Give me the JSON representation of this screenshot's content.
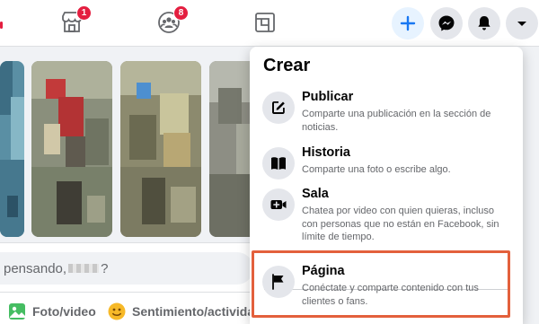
{
  "topbar": {
    "nav": [
      {
        "name": "marketplace",
        "badge": "1"
      },
      {
        "name": "groups",
        "badge": "8"
      },
      {
        "name": "gaming",
        "badge": ""
      }
    ],
    "actions": [
      "create",
      "messenger",
      "notifications",
      "account-menu"
    ]
  },
  "composer": {
    "placeholder_start": "pensando,",
    "placeholder_end": "?",
    "actions": [
      {
        "label": "Foto/video",
        "icon": "photo-icon"
      },
      {
        "label": "Sentimiento/actividad",
        "icon": "feeling-icon"
      }
    ]
  },
  "create_menu": {
    "title": "Crear",
    "items": [
      {
        "label": "Publicar",
        "description": "Comparte una publicación en la sección de noticias.",
        "icon": "compose-icon"
      },
      {
        "label": "Historia",
        "description": "Comparte una foto o escribe algo.",
        "icon": "book-icon"
      },
      {
        "label": "Sala",
        "description": "Chatea por video con quien quieras, incluso con personas que no están en Facebook, sin límite de tiempo.",
        "icon": "video-plus-icon"
      },
      {
        "label": "Página",
        "description": "Conéctate y comparte contenido con tus clientes o fans.",
        "icon": "flag-icon"
      }
    ]
  },
  "colors": {
    "brand_blue": "#1877f2",
    "badge_red": "#e41e3f",
    "highlight": "#e3603c"
  }
}
